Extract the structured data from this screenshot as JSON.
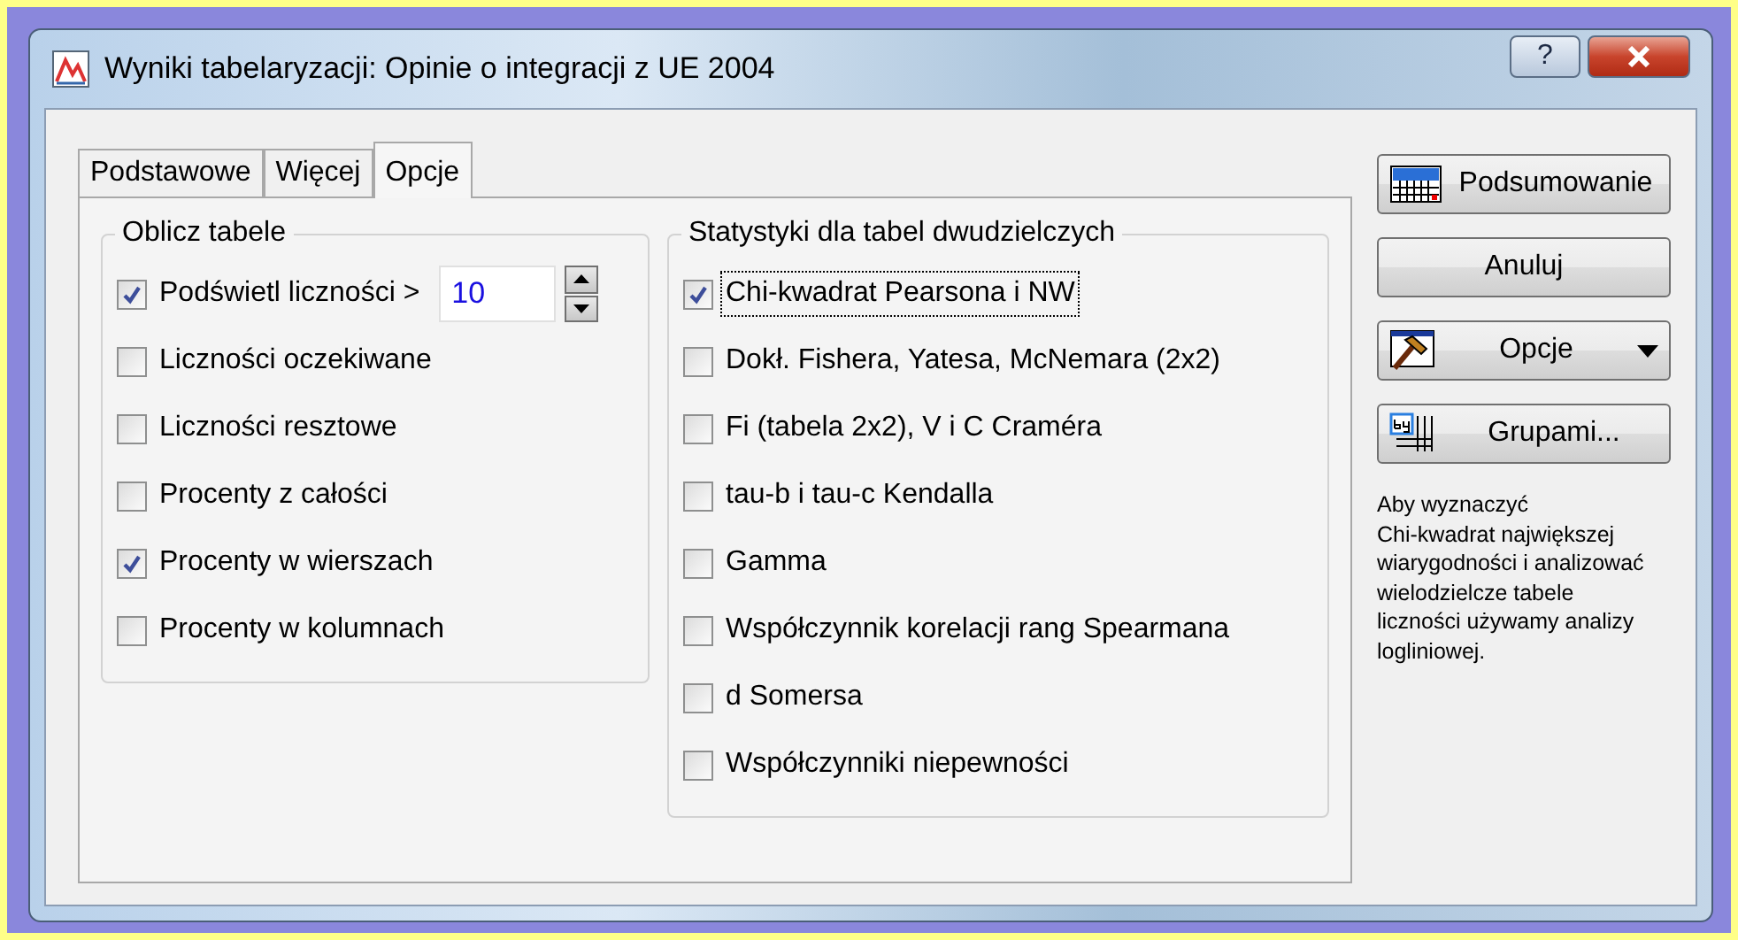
{
  "window": {
    "title": "Wyniki tabelaryzacji: Opinie o integracji z UE 2004",
    "help_button": "?"
  },
  "tabs": [
    {
      "label": "Podstawowe",
      "selected": false
    },
    {
      "label": "Więcej",
      "selected": false
    },
    {
      "label": "Opcje",
      "selected": true
    }
  ],
  "compute_group": {
    "title": "Oblicz tabele",
    "items": [
      {
        "kind": "threshold",
        "label": "Podświetl liczności >",
        "checked": true,
        "value": "10"
      },
      {
        "kind": "checkbox",
        "label": "Liczności oczekiwane",
        "checked": false
      },
      {
        "kind": "checkbox",
        "label": "Liczności resztowe",
        "checked": false
      },
      {
        "kind": "checkbox",
        "label": "Procenty z całości",
        "checked": false
      },
      {
        "kind": "checkbox",
        "label": "Procenty w wierszach",
        "checked": true
      },
      {
        "kind": "checkbox",
        "label": "Procenty w kolumnach",
        "checked": false
      }
    ]
  },
  "stats_group": {
    "title": "Statystyki dla tabel dwudzielczych",
    "items": [
      {
        "label": "Chi-kwadrat Pearsona i NW",
        "checked": true,
        "focused": true
      },
      {
        "label": "Dokł. Fishera, Yatesa, McNemara (2x2)",
        "checked": false,
        "focused": false
      },
      {
        "label": "Fi (tabela 2x2), V i C Craméra",
        "checked": false,
        "focused": false
      },
      {
        "label": "tau-b i tau-c Kendalla",
        "checked": false,
        "focused": false
      },
      {
        "label": "Gamma",
        "checked": false,
        "focused": false
      },
      {
        "label": "Współczynnik korelacji rang Spearmana",
        "checked": false,
        "focused": false
      },
      {
        "label": "d Somersa",
        "checked": false,
        "focused": false
      },
      {
        "label": "Współczynniki niepewności",
        "checked": false,
        "focused": false
      }
    ]
  },
  "buttons": [
    {
      "kind": "summary",
      "label": "Podsumowanie"
    },
    {
      "kind": "plain",
      "label": "Anuluj"
    },
    {
      "kind": "menu",
      "label": "Opcje"
    },
    {
      "kind": "groups",
      "label": "Grupami..."
    }
  ],
  "help_text": "Aby wyznaczyć\nChi-kwadrat największej\nwiarygodności i analizować\nwielodzielcze tabele\nliczności używamy analizy\nlogliniowej."
}
